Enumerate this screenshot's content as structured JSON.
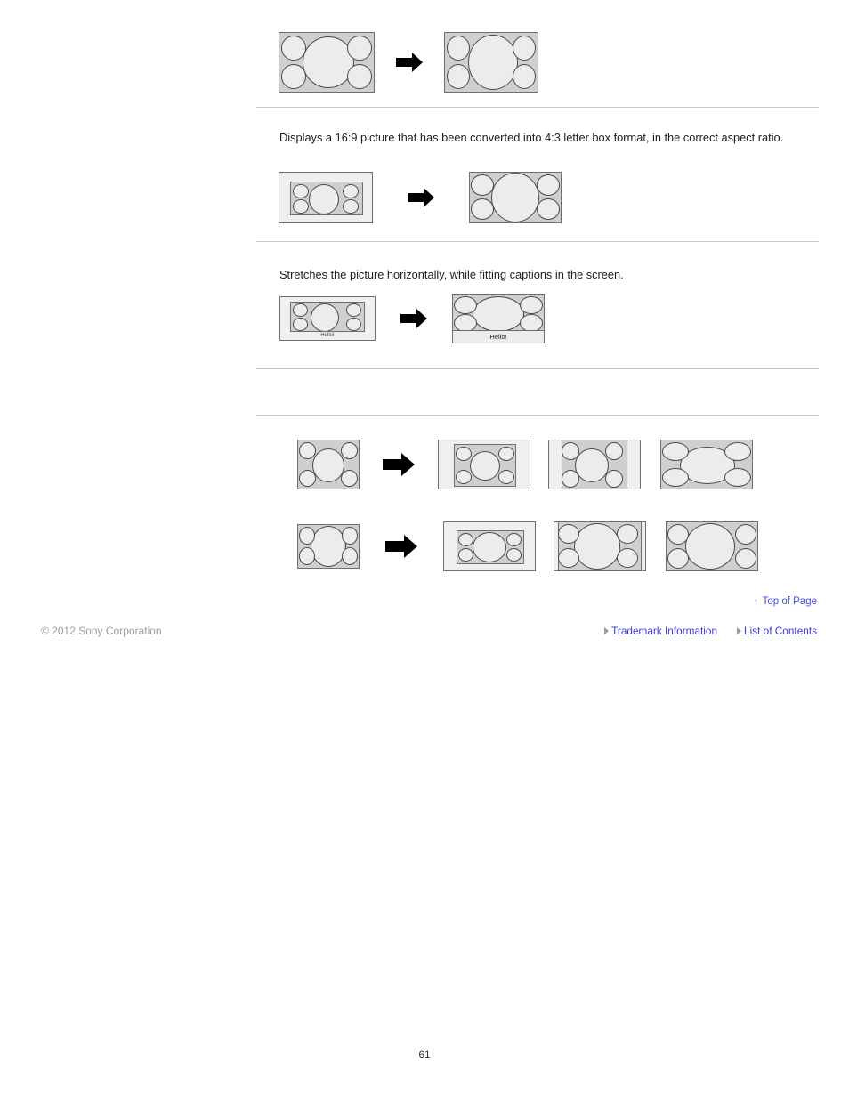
{
  "page": {
    "number": "61",
    "copyright": "© 2012 Sony Corporation"
  },
  "sections": [
    {
      "id": "section-normal",
      "description": "",
      "diagram": {
        "source_label": "16:9 source picture",
        "result_label": "displayed picture",
        "arrow": "right-arrow-icon"
      }
    },
    {
      "id": "section-letterbox",
      "description": "Displays a 16:9 picture that has been converted into 4:3 letter box format, in the correct aspect ratio.",
      "diagram": {
        "source_label": "4:3 letter box source picture",
        "result_label": "displayed picture",
        "arrow": "right-arrow-icon"
      }
    },
    {
      "id": "section-captions",
      "description": "Stretches the picture horizontally, while fitting captions in the screen.",
      "caption_text": "Hello!",
      "diagram": {
        "source_label": "4:3 letter box source picture with captions",
        "result_label": "displayed picture with captions",
        "arrow": "right-arrow-icon"
      }
    },
    {
      "id": "section-blank",
      "description": ""
    }
  ],
  "comparison": {
    "rows": [
      {
        "id": "comparison-row-4to3",
        "source_label": "4:3 source picture",
        "arrow": "right-arrow-icon",
        "variants": [
          "normal",
          "zoom",
          "wide"
        ]
      },
      {
        "id": "comparison-row-16to9",
        "source_label": "16:9 source picture",
        "arrow": "right-arrow-icon",
        "variants": [
          "normal",
          "zoom",
          "wide"
        ]
      }
    ]
  },
  "footer": {
    "top_of_page": "Top of Page",
    "top_of_page_icon": "up-arrow-icon",
    "links": [
      {
        "label": "Trademark Information",
        "icon": "triangle-right-icon"
      },
      {
        "label": "List of Contents",
        "icon": "triangle-right-icon"
      }
    ]
  },
  "colors": {
    "link": "#3a3ad0",
    "divider": "#c8c8c8",
    "screen_bg": "#cfcfcf",
    "blob_fill": "#ececec",
    "letterbox_frame": "#efefef",
    "copyright_text": "#9b9b9b"
  }
}
